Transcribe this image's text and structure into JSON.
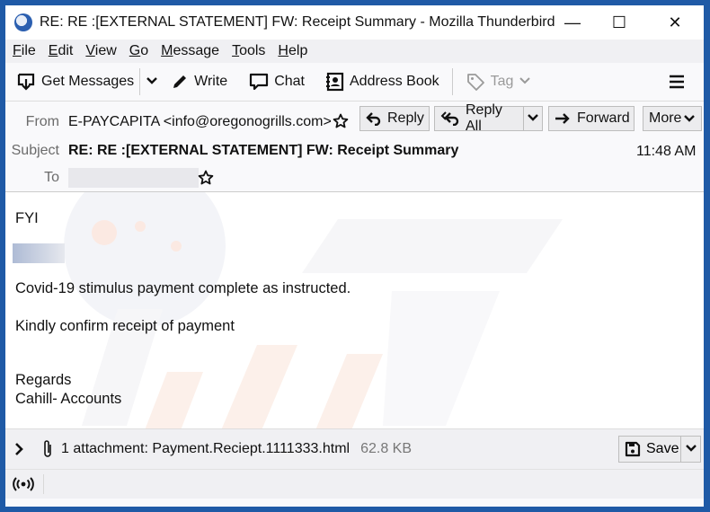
{
  "window": {
    "title": "RE: RE :[EXTERNAL STATEMENT] FW: Receipt Summary - Mozilla Thunderbird",
    "controls": {
      "minimize": "—",
      "maximize": "☐",
      "close": "✕"
    }
  },
  "menu": {
    "items": [
      {
        "label": "File",
        "accel": "F",
        "rest": "ile"
      },
      {
        "label": "Edit",
        "accel": "E",
        "rest": "dit"
      },
      {
        "label": "View",
        "accel": "V",
        "rest": "iew"
      },
      {
        "label": "Go",
        "accel": "G",
        "rest": "o"
      },
      {
        "label": "Message",
        "accel": "M",
        "rest": "essage"
      },
      {
        "label": "Tools",
        "accel": "T",
        "rest": "ools"
      },
      {
        "label": "Help",
        "accel": "H",
        "rest": "elp"
      }
    ]
  },
  "toolbar": {
    "get_messages": "Get Messages",
    "write": "Write",
    "chat": "Chat",
    "address_book": "Address Book",
    "tag": "Tag",
    "menu_icon": "hamburger-icon"
  },
  "header": {
    "from_label": "From",
    "from_value": "E-PAYCAPITA <info@oregonogrills.com>",
    "subject_label": "Subject",
    "subject_value": "RE: RE :[EXTERNAL STATEMENT] FW: Receipt Summary",
    "to_label": "To",
    "to_value": "",
    "time": "11:48 AM",
    "buttons": {
      "reply": "Reply",
      "reply_all": "Reply All",
      "forward": "Forward",
      "more": "More"
    }
  },
  "message": {
    "greeting": "FYI",
    "line1": "Covid-19 stimulus payment complete as instructed.",
    "line2": "Kindly confirm receipt of payment",
    "closing": "Regards",
    "signature": "Cahill- Accounts"
  },
  "attachment": {
    "summary": "1 attachment: Payment.Reciept.1111333.html",
    "size": "62.8 KB",
    "save_label": "Save"
  },
  "colors": {
    "window_border": "#1f5aa6",
    "watermark": "#f3d9cf"
  }
}
